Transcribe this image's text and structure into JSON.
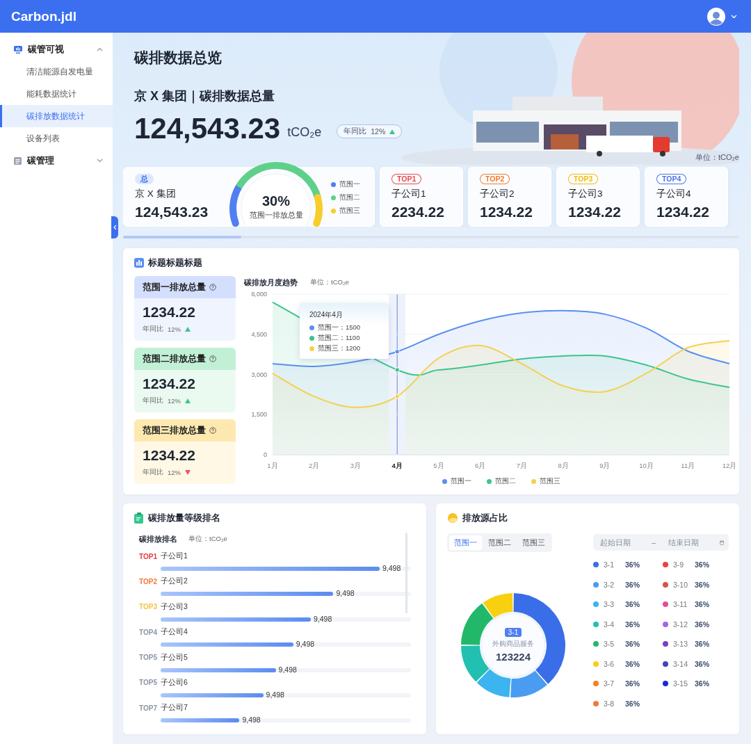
{
  "header": {
    "logo": "Carbon.jdl"
  },
  "sidebar": {
    "groups": [
      {
        "label": "碳管可视",
        "expanded": true,
        "items": [
          {
            "label": "清洁能源自发电量",
            "selected": false
          },
          {
            "label": "能耗数据统计",
            "selected": false
          },
          {
            "label": "碳排放数据统计",
            "selected": true
          },
          {
            "label": "设备列表",
            "selected": false
          }
        ]
      },
      {
        "label": "碳管理",
        "expanded": false
      }
    ]
  },
  "overview": {
    "title": "碳排数据总览",
    "subtitle": "京 X 集团｜碳排数据总量",
    "total": "124,543.23",
    "unit": "tCO₂e",
    "yoy": {
      "label": "年同比",
      "value": "12%",
      "up": true
    },
    "unit_note": "单位：tCO₂e"
  },
  "summary_card": {
    "tag": "总",
    "name": "京 X 集团",
    "value": "124,543.23",
    "gauge": {
      "percent": "30%",
      "caption": "范围一排放总量"
    },
    "legend": [
      {
        "label": "范围一",
        "color": "#4f7ff0"
      },
      {
        "label": "范围二",
        "color": "#5fd08a"
      },
      {
        "label": "范围三",
        "color": "#f8cd2a"
      }
    ]
  },
  "company_cards": [
    {
      "rank": "TOP1",
      "name": "子公司1",
      "value": "2234.22",
      "color": "#e5484d"
    },
    {
      "rank": "TOP2",
      "name": "子公司2",
      "value": "1234.22",
      "color": "#f07a2e"
    },
    {
      "rank": "TOP3",
      "name": "子公司3",
      "value": "1234.22",
      "color": "#f2b90c"
    },
    {
      "rank": "TOP4",
      "name": "子公司4",
      "value": "1234.22",
      "color": "#4a72e8"
    }
  ],
  "emissions": {
    "title": "标题标题标题",
    "scope_cards": [
      {
        "title": "范围一排放总量",
        "value": "1234.22",
        "yoy_label": "年同比",
        "yoy_value": "12%",
        "up": true,
        "color": "#d3dffd"
      },
      {
        "title": "范围二排放总量",
        "value": "1234.22",
        "yoy_label": "年同比",
        "yoy_value": "12%",
        "up": true,
        "color": "#c2f0d6"
      },
      {
        "title": "范围三排放总量",
        "value": "1234.22",
        "yoy_label": "年同比",
        "yoy_value": "12%",
        "up": false,
        "color": "#fde9b0"
      }
    ],
    "chart": {
      "title": "碳排放月度趋势",
      "unit": "单位：tCO₂e",
      "tooltip": {
        "title": "2024年4月",
        "rows": [
          "范围一：1500",
          "范围二：1100",
          "范围三：1200"
        ]
      },
      "chart_data": {
        "type": "line",
        "grid": true,
        "categories": [
          "1月",
          "2月",
          "3月",
          "4月",
          "5月",
          "6月",
          "7月",
          "8月",
          "9月",
          "10月",
          "11月",
          "12月"
        ],
        "ylim": [
          0,
          6000
        ],
        "yticks": [
          0,
          {
            "value": 1500,
            "label": "1,500"
          },
          {
            "value": 3000,
            "label": "3,000"
          },
          {
            "value": 4500,
            "label": "4,500"
          },
          {
            "value": 6000,
            "label": "6,000"
          }
        ],
        "series": [
          {
            "name": "范围一",
            "color": "#5b8ff0",
            "values": [
              3400,
              3300,
              3480,
              3850,
              4500,
              5000,
              5300,
              5380,
              5250,
              4730,
              3870,
              3400
            ]
          },
          {
            "name": "范围二",
            "color": "#3cc48e",
            "values": [
              5700,
              null,
              null,
              3170,
              3170,
              3350,
              3580,
              3690,
              3690,
              3350,
              2830,
              2520
            ]
          },
          {
            "name": "范围三",
            "color": "#f5d04f",
            "values": [
              3040,
              2180,
              1770,
              2180,
              3610,
              4080,
              3400,
              2570,
              2360,
              3040,
              4000,
              4260
            ]
          }
        ]
      }
    }
  },
  "ranking": {
    "title": "碳排放量等级排名",
    "subtitle": "碳排放排名",
    "unit": "单位：tCO₂e",
    "rows": [
      {
        "rank": "TOP1",
        "name": "子公司1",
        "value": "9,498",
        "level": 0.875,
        "color": "#e0393e"
      },
      {
        "rank": "TOP2",
        "name": "子公司2",
        "value": "9,498",
        "level": 0.69,
        "color": "#f07a3a"
      },
      {
        "rank": "TOP3",
        "name": "子公司3",
        "value": "9,498",
        "level": 0.6,
        "color": "#f5c242"
      },
      {
        "rank": "TOP4",
        "name": "子公司4",
        "value": "9,498",
        "level": 0.53,
        "color": "#8a94a6"
      },
      {
        "rank": "TOP5",
        "name": "子公司5",
        "value": "9,498",
        "level": 0.46,
        "color": "#8a94a6"
      },
      {
        "rank": "TOP5",
        "name": "子公司6",
        "value": "9,498",
        "level": 0.41,
        "color": "#8a94a6"
      },
      {
        "rank": "TOP7",
        "name": "子公司7",
        "value": "9,498",
        "level": 0.315,
        "color": "#8a94a6"
      }
    ]
  },
  "sources": {
    "title": "排放源占比",
    "tabs": [
      {
        "label": "范围一",
        "selected": true
      },
      {
        "label": "范围二",
        "selected": false
      },
      {
        "label": "范围三",
        "selected": false
      }
    ],
    "date_range": {
      "start_placeholder": "起始日期",
      "separator": "–",
      "end_placeholder": "结束日期"
    },
    "center": {
      "tag": "3-1",
      "caption": "外购商品服务",
      "value": "123224"
    },
    "legend": [
      {
        "label": "3-1",
        "value": "36%",
        "color": "#3a6ee8"
      },
      {
        "label": "3-2",
        "value": "36%",
        "color": "#4a9cf0"
      },
      {
        "label": "3-3",
        "value": "36%",
        "color": "#3cb4f0"
      },
      {
        "label": "3-4",
        "value": "36%",
        "color": "#22c0b0"
      },
      {
        "label": "3-5",
        "value": "36%",
        "color": "#22b86a"
      },
      {
        "label": "3-6",
        "value": "36%",
        "color": "#f8d010"
      },
      {
        "label": "3-7",
        "value": "36%",
        "color": "#f58220"
      },
      {
        "label": "3-8",
        "value": "36%",
        "color": "#ec7a40"
      },
      {
        "label": "3-9",
        "value": "36%",
        "color": "#ec4040"
      },
      {
        "label": "3-10",
        "value": "36%",
        "color": "#e05040"
      },
      {
        "label": "3-11",
        "value": "36%",
        "color": "#e84a9c"
      },
      {
        "label": "3-12",
        "value": "36%",
        "color": "#a864e8"
      },
      {
        "label": "3-13",
        "value": "36%",
        "color": "#7840c0"
      },
      {
        "label": "3-14",
        "value": "36%",
        "color": "#3c48b8"
      },
      {
        "label": "3-15",
        "value": "36%",
        "color": "#1c28d8"
      }
    ]
  }
}
